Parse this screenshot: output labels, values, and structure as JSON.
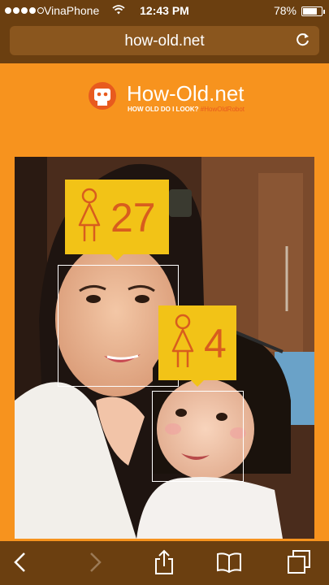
{
  "status_bar": {
    "carrier": "VinaPhone",
    "time": "12:43 PM",
    "battery_label": "78%",
    "battery_level": 0.78,
    "signal_bars": 4,
    "signal_total": 5
  },
  "browser": {
    "url": "how-old.net",
    "reload_icon": "reload-icon"
  },
  "page": {
    "title": "How-Old.net",
    "subtitle": "HOW OLD DO I LOOK?",
    "hashtag": "#HowOldRobot"
  },
  "faces": [
    {
      "gender": "female",
      "age": "27"
    },
    {
      "gender": "female",
      "age": "4"
    }
  ],
  "toolbar": {
    "back_icon": "back-icon",
    "forward_icon": "forward-icon",
    "share_icon": "share-icon",
    "bookmarks_icon": "bookmarks-icon",
    "tabs_icon": "tabs-icon"
  },
  "colors": {
    "page_background": "#f7931e",
    "chrome": "#6b3f10",
    "tag_yellow": "#f2c317",
    "age_orange": "#d85d1e"
  }
}
